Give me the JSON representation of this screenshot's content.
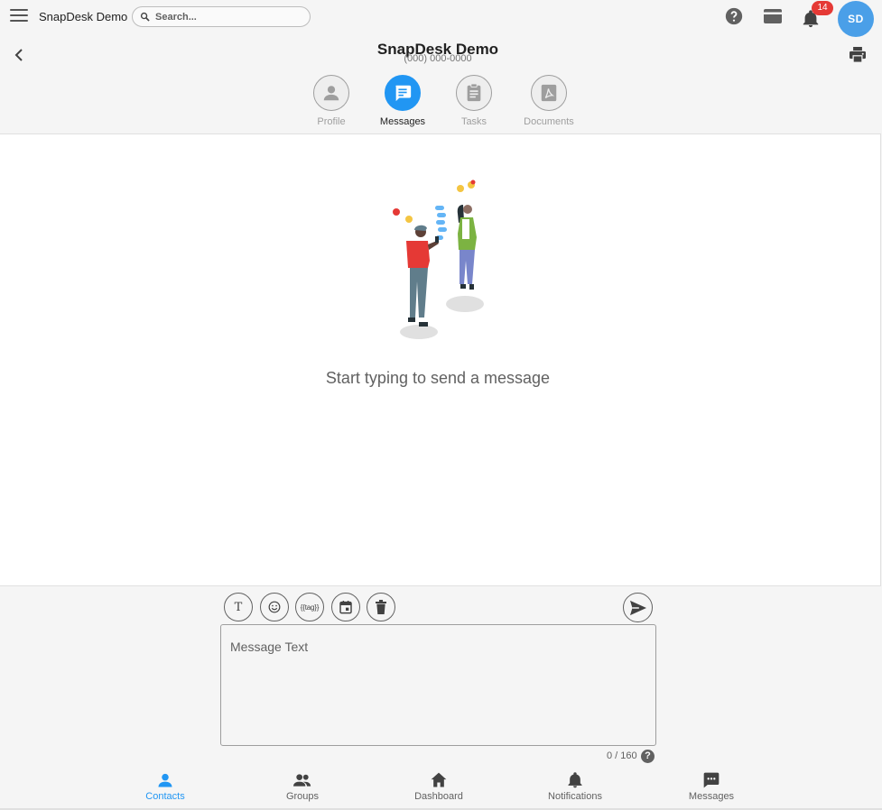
{
  "topbar": {
    "app_title": "SnapDesk Demo",
    "search_placeholder": "Search...",
    "notification_count": "14",
    "avatar_initials": "SD"
  },
  "contact": {
    "name": "SnapDesk Demo",
    "phone": "(000) 000-0000"
  },
  "tabs": [
    {
      "label": "Profile",
      "icon": "person-icon"
    },
    {
      "label": "Messages",
      "icon": "chat-icon",
      "active": true
    },
    {
      "label": "Tasks",
      "icon": "clipboard-icon"
    },
    {
      "label": "Documents",
      "icon": "pdf-icon"
    }
  ],
  "main": {
    "empty_text": "Start typing to send a message"
  },
  "composer": {
    "tools": [
      {
        "name": "text-format-icon",
        "glyph": "T"
      },
      {
        "name": "emoji-icon"
      },
      {
        "name": "tag-icon",
        "glyph": "{{tag}}"
      },
      {
        "name": "calendar-icon"
      },
      {
        "name": "trash-icon"
      }
    ],
    "message_placeholder": "Message Text",
    "char_count": "0 / 160"
  },
  "bottom_nav": [
    {
      "label": "Contacts",
      "icon": "person-icon",
      "active": true
    },
    {
      "label": "Groups",
      "icon": "group-icon"
    },
    {
      "label": "Dashboard",
      "icon": "home-icon"
    },
    {
      "label": "Notifications",
      "icon": "bell-icon"
    },
    {
      "label": "Messages",
      "icon": "chat-icon"
    }
  ],
  "colors": {
    "accent": "#2196f3",
    "badge": "#e53935",
    "avatar": "#4a9fe8"
  }
}
